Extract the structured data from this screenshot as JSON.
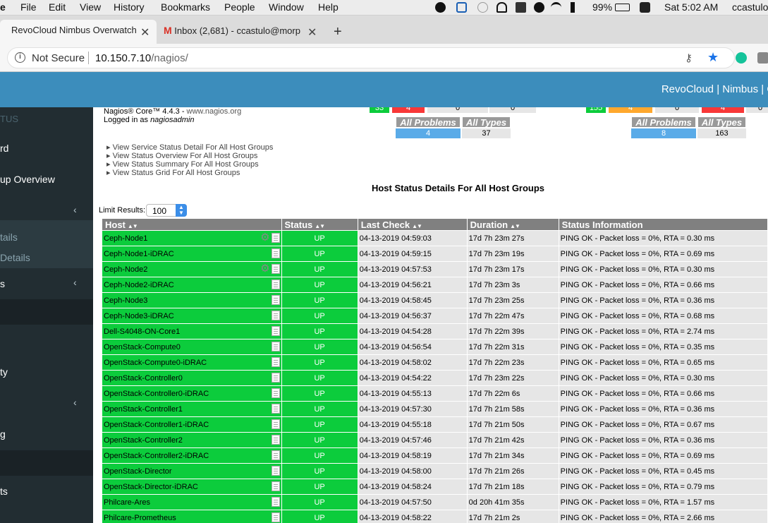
{
  "menubar": {
    "app_fragment": "e",
    "items": [
      "File",
      "Edit",
      "View",
      "History",
      "Bookmarks",
      "People",
      "Window",
      "Help"
    ],
    "battery": "99%",
    "clock": "Sat 5:02 AM",
    "user": "ccastulo"
  },
  "tabs": [
    {
      "title": "RevoCloud Nimbus Overwatch",
      "close": "✕"
    },
    {
      "title": "Inbox (2,681) - ccastulo@morp",
      "close": "✕"
    }
  ],
  "new_tab": "+",
  "address": {
    "security": "Not Secure",
    "host": "10.150.7.10",
    "path": "/nagios/"
  },
  "app": {
    "title": "RevoCloud | Nimbus | O"
  },
  "sidebar": {
    "items": [
      {
        "label": "TUS",
        "chevron": ""
      },
      {
        "label": "rd",
        "chevron": ""
      },
      {
        "label": "up Overview",
        "chevron": ""
      },
      {
        "label": "",
        "chevron": "‹"
      },
      {
        "label": "tails",
        "chevron": ""
      },
      {
        "label": "Details",
        "chevron": ""
      },
      {
        "label": "s",
        "chevron": "‹"
      },
      {
        "label": "ty",
        "chevron": ""
      },
      {
        "label": "",
        "chevron": "‹"
      },
      {
        "label": "g",
        "chevron": ""
      },
      {
        "label": "ts",
        "chevron": ""
      }
    ]
  },
  "nagios": {
    "version": "Nagios® Core™ 4.4.3 - ",
    "site": "www.nagios.org",
    "logged_prefix": "Logged in as ",
    "user": "nagiosadmin",
    "links": [
      "View Service Status Detail For All Host Groups",
      "View Status Overview For All Host Groups",
      "View Status Summary For All Host Groups",
      "View Status Grid For All Host Groups"
    ],
    "page_title": "Host Status Details For All Host Groups",
    "limit_label": "Limit Results:",
    "limit_value": "100"
  },
  "host_totals": {
    "top_values": [
      "33",
      "4",
      "0",
      "0"
    ],
    "all_problems_label": "All Problems",
    "all_types_label": "All Types",
    "all_problems": "4",
    "all_types": "37"
  },
  "service_totals": {
    "top_values": [
      "155",
      "4",
      "0",
      "4",
      "0"
    ],
    "all_problems_label": "All Problems",
    "all_types_label": "All Types",
    "all_problems": "8",
    "all_types": "163"
  },
  "colors": {
    "up_green": "#0ccc3c",
    "header_blue": "#3c8dbc",
    "sidebar_dark": "#222d32",
    "problem_blue": "#5aabe8",
    "critical_red": "#f83838",
    "warning_orange": "#ffa82e"
  },
  "table": {
    "columns": [
      "Host",
      "Status",
      "Last Check",
      "Duration",
      "Status Information"
    ],
    "rows": [
      {
        "host": "Ceph-Node1",
        "gear": true,
        "status": "UP",
        "last_check": "04-13-2019 04:59:03",
        "duration": "17d 7h 23m 27s",
        "info": "PING OK - Packet loss = 0%, RTA = 0.30 ms"
      },
      {
        "host": "Ceph-Node1-iDRAC",
        "gear": false,
        "status": "UP",
        "last_check": "04-13-2019 04:59:15",
        "duration": "17d 7h 23m 19s",
        "info": "PING OK - Packet loss = 0%, RTA = 0.69 ms"
      },
      {
        "host": "Ceph-Node2",
        "gear": true,
        "status": "UP",
        "last_check": "04-13-2019 04:57:53",
        "duration": "17d 7h 23m 17s",
        "info": "PING OK - Packet loss = 0%, RTA = 0.30 ms"
      },
      {
        "host": "Ceph-Node2-iDRAC",
        "gear": false,
        "status": "UP",
        "last_check": "04-13-2019 04:56:21",
        "duration": "17d 7h 23m 3s",
        "info": "PING OK - Packet loss = 0%, RTA = 0.66 ms"
      },
      {
        "host": "Ceph-Node3",
        "gear": false,
        "status": "UP",
        "last_check": "04-13-2019 04:58:45",
        "duration": "17d 7h 23m 25s",
        "info": "PING OK - Packet loss = 0%, RTA = 0.36 ms"
      },
      {
        "host": "Ceph-Node3-iDRAC",
        "gear": false,
        "status": "UP",
        "last_check": "04-13-2019 04:56:37",
        "duration": "17d 7h 22m 47s",
        "info": "PING OK - Packet loss = 0%, RTA = 0.68 ms"
      },
      {
        "host": "Dell-S4048-ON-Core1",
        "gear": false,
        "status": "UP",
        "last_check": "04-13-2019 04:54:28",
        "duration": "17d 7h 22m 39s",
        "info": "PING OK - Packet loss = 0%, RTA = 2.74 ms"
      },
      {
        "host": "OpenStack-Compute0",
        "gear": false,
        "status": "UP",
        "last_check": "04-13-2019 04:56:54",
        "duration": "17d 7h 22m 31s",
        "info": "PING OK - Packet loss = 0%, RTA = 0.35 ms"
      },
      {
        "host": "OpenStack-Compute0-iDRAC",
        "gear": false,
        "status": "UP",
        "last_check": "04-13-2019 04:58:02",
        "duration": "17d 7h 22m 23s",
        "info": "PING OK - Packet loss = 0%, RTA = 0.65 ms"
      },
      {
        "host": "OpenStack-Controller0",
        "gear": false,
        "status": "UP",
        "last_check": "04-13-2019 04:54:22",
        "duration": "17d 7h 23m 22s",
        "info": "PING OK - Packet loss = 0%, RTA = 0.30 ms"
      },
      {
        "host": "OpenStack-Controller0-iDRAC",
        "gear": false,
        "status": "UP",
        "last_check": "04-13-2019 04:55:13",
        "duration": "17d 7h 22m 6s",
        "info": "PING OK - Packet loss = 0%, RTA = 0.66 ms"
      },
      {
        "host": "OpenStack-Controller1",
        "gear": false,
        "status": "UP",
        "last_check": "04-13-2019 04:57:30",
        "duration": "17d 7h 21m 58s",
        "info": "PING OK - Packet loss = 0%, RTA = 0.36 ms"
      },
      {
        "host": "OpenStack-Controller1-iDRAC",
        "gear": false,
        "status": "UP",
        "last_check": "04-13-2019 04:55:18",
        "duration": "17d 7h 21m 50s",
        "info": "PING OK - Packet loss = 0%, RTA = 0.67 ms"
      },
      {
        "host": "OpenStack-Controller2",
        "gear": false,
        "status": "UP",
        "last_check": "04-13-2019 04:57:46",
        "duration": "17d 7h 21m 42s",
        "info": "PING OK - Packet loss = 0%, RTA = 0.36 ms"
      },
      {
        "host": "OpenStack-Controller2-iDRAC",
        "gear": false,
        "status": "UP",
        "last_check": "04-13-2019 04:58:19",
        "duration": "17d 7h 21m 34s",
        "info": "PING OK - Packet loss = 0%, RTA = 0.69 ms"
      },
      {
        "host": "OpenStack-Director",
        "gear": false,
        "status": "UP",
        "last_check": "04-13-2019 04:58:00",
        "duration": "17d 7h 21m 26s",
        "info": "PING OK - Packet loss = 0%, RTA = 0.45 ms"
      },
      {
        "host": "OpenStack-Director-iDRAC",
        "gear": false,
        "status": "UP",
        "last_check": "04-13-2019 04:58:24",
        "duration": "17d 7h 21m 18s",
        "info": "PING OK - Packet loss = 0%, RTA = 0.79 ms"
      },
      {
        "host": "Philcare-Ares",
        "gear": false,
        "status": "UP",
        "last_check": "04-13-2019 04:57:50",
        "duration": "0d 20h 41m 35s",
        "info": "PING OK - Packet loss = 0%, RTA = 1.57 ms"
      },
      {
        "host": "Philcare-Prometheus",
        "gear": false,
        "status": "UP",
        "last_check": "04-13-2019 04:58:22",
        "duration": "17d 7h 21m 2s",
        "info": "PING OK - Packet loss = 0%, RTA = 2.66 ms"
      }
    ]
  }
}
